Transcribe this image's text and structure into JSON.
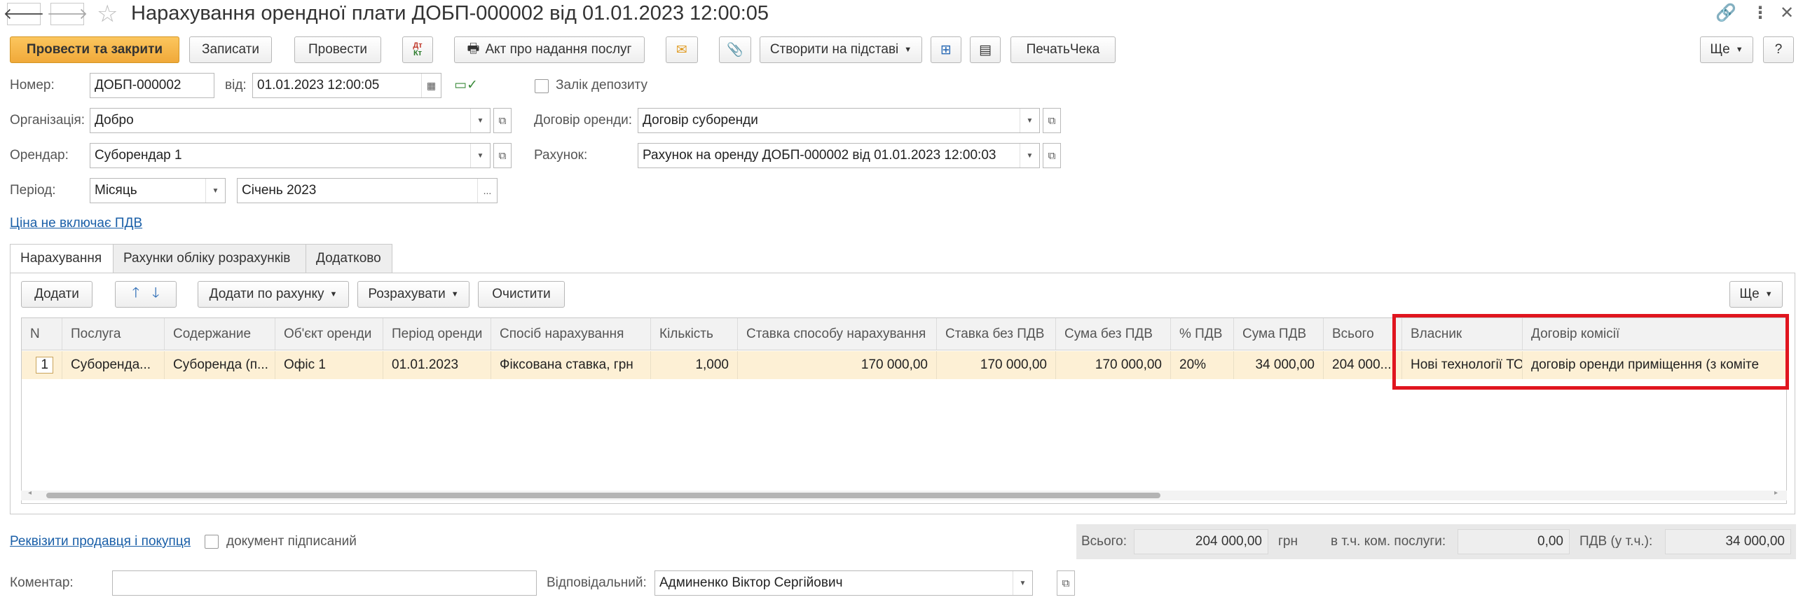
{
  "window": {
    "title": "Нарахування орендної плати ДОБП-000002 від 01.01.2023 12:00:05"
  },
  "toolbar": {
    "post_close": "Провести та закрити",
    "save": "Записати",
    "post": "Провести",
    "act": "Акт про надання послуг",
    "create_based": "Створити на підставі",
    "print_check": "ПечатьЧека",
    "more": "Ще",
    "help": "?"
  },
  "form": {
    "number_label": "Номер:",
    "number_value": "ДОБП-000002",
    "date_label": "від:",
    "date_value": "01.01.2023 12:00:05",
    "deposit_label": "Залік депозиту",
    "org_label": "Організація:",
    "org_value": "Добро",
    "contract_label": "Договір оренди:",
    "contract_value": "Договір суборенди",
    "tenant_label": "Орендар:",
    "tenant_value": "Суборендар 1",
    "invoice_label": "Рахунок:",
    "invoice_value": "Рахунок на оренду ДОБП-000002 від 01.01.2023 12:00:03",
    "period_label": "Період:",
    "period_type": "Місяць",
    "period_value": "Січень 2023",
    "vat_link": "Ціна не включає ПДВ"
  },
  "tabs": [
    "Нарахування",
    "Рахунки обліку розрахунків",
    "Додатково"
  ],
  "table_toolbar": {
    "add": "Додати",
    "add_by_invoice": "Додати по рахунку",
    "calculate": "Розрахувати",
    "clear": "Очистити",
    "more": "Ще"
  },
  "table": {
    "columns": [
      "N",
      "Послуга",
      "Содержание",
      "Об'єкт оренди",
      "Період оренди",
      "Спосіб нарахування",
      "Кількість",
      "Ставка способу нарахування",
      "Ставка без ПДВ",
      "Сума без ПДВ",
      "% ПДВ",
      "Сума ПДВ",
      "Всього",
      "Власник",
      "Договір комісії"
    ],
    "rows": [
      [
        "1",
        "Суборенда...",
        "Суборенда (п...",
        "Офіс 1",
        "01.01.2023",
        "Фіксована ставка, грн",
        "1,000",
        "170 000,00",
        "170 000,00",
        "170 000,00",
        "20%",
        "34 000,00",
        "204 000...",
        "Нові технології ТОВ",
        "договір оренди приміщення (з коміте"
      ]
    ]
  },
  "footer": {
    "requisites_link": "Реквізити продавця і покупця",
    "signed_label": "документ підписаний",
    "total_label": "Всього:",
    "total_value": "204 000,00",
    "currency": "грн",
    "commission_label": "в т.ч. ком. послуги:",
    "commission_value": "0,00",
    "vat_label": "ПДВ (у т.ч.):",
    "vat_value": "34 000,00",
    "comment_label": "Коментар:",
    "comment_value": "",
    "responsible_label": "Відповідальний:",
    "responsible_value": "Админенко Віктор Сергійович"
  },
  "colors": {
    "primary_button": "#f5b445",
    "selected_row": "#fdf0d5",
    "highlight_box": "#e0151f",
    "link": "#1a5fa8"
  }
}
